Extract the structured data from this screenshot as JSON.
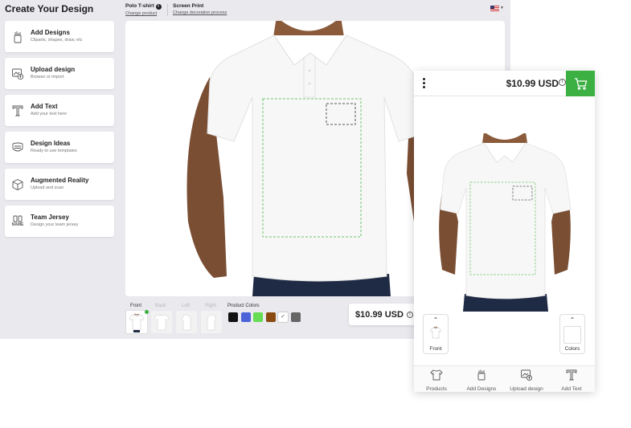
{
  "sidebar": {
    "title": "Create Your Design",
    "tools": [
      {
        "name": "Add Designs",
        "sub": "Cliparts, shapes, draw, etc",
        "icon": "add-designs-icon"
      },
      {
        "name": "Upload design",
        "sub": "Browse or import",
        "icon": "upload-design-icon"
      },
      {
        "name": "Add Text",
        "sub": "Add your text here",
        "icon": "text-icon"
      },
      {
        "name": "Design Ideas",
        "sub": "Ready to use templates",
        "icon": "design-ideas-icon"
      },
      {
        "name": "Augmented Reality",
        "sub": "Upload and scan",
        "icon": "augmented-reality-icon"
      },
      {
        "name": "Team Jersey",
        "sub": "Design your team jersey",
        "icon": "team-jersey-icon",
        "icon_text": "NAME"
      }
    ]
  },
  "header": {
    "product": "Polo T-shirt",
    "product_link": "Change product",
    "print": "Screen Print",
    "print_link": "Change decoration process",
    "flag_icon": "us-flag-icon"
  },
  "views": [
    {
      "label": "Front",
      "active": true
    },
    {
      "label": "Back",
      "active": false
    },
    {
      "label": "Left",
      "active": false
    },
    {
      "label": "Right",
      "active": false
    }
  ],
  "colors": {
    "label": "Product Colors",
    "swatches": [
      "#111111",
      "#4a63d8",
      "#66dd55",
      "#8a4a10",
      "#ffffff",
      "#666666"
    ],
    "selected_index": 4
  },
  "price": {
    "amount": "$10.99 USD",
    "info": "i"
  },
  "mobile": {
    "price": "$10.99 USD",
    "info": "i",
    "front_label": "Front",
    "colors_label": "Colors",
    "nav": [
      {
        "label": "Products",
        "icon": "products-icon"
      },
      {
        "label": "Add Designs",
        "icon": "add-designs-icon"
      },
      {
        "label": "Upload design",
        "icon": "upload-design-icon"
      },
      {
        "label": "Add Text",
        "icon": "text-icon"
      }
    ],
    "accent": "#3cb043"
  }
}
